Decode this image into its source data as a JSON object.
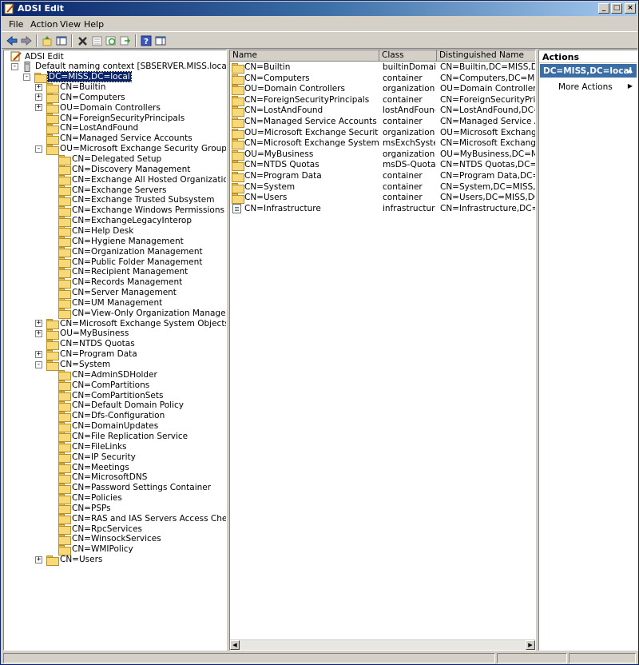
{
  "window": {
    "title": "ADSI Edit"
  },
  "menu": [
    "File",
    "Action",
    "View",
    "Help"
  ],
  "toolbar": [
    "back-icon",
    "forward-icon",
    "up-icon",
    "show-hide-tree-icon",
    "delete-icon",
    "properties-icon",
    "refresh-icon",
    "export-icon",
    "help-icon",
    "action-pane-icon"
  ],
  "tree": [
    {
      "label": "ADSI Edit",
      "level": 0,
      "expander": "",
      "icon": "adsi-icon"
    },
    {
      "label": "Default naming context [SBSERVER.MISS.local]",
      "level": 1,
      "expander": "-",
      "icon": "server-icon"
    },
    {
      "label": "DC=MISS,DC=local",
      "level": 2,
      "expander": "-",
      "icon": "folder",
      "selected": true
    },
    {
      "label": "CN=Builtin",
      "level": 3,
      "expander": "+",
      "icon": "folder"
    },
    {
      "label": "CN=Computers",
      "level": 3,
      "expander": "+",
      "icon": "folder"
    },
    {
      "label": "OU=Domain Controllers",
      "level": 3,
      "expander": "+",
      "icon": "folder"
    },
    {
      "label": "CN=ForeignSecurityPrincipals",
      "level": 3,
      "expander": "",
      "icon": "folder"
    },
    {
      "label": "CN=LostAndFound",
      "level": 3,
      "expander": "",
      "icon": "folder"
    },
    {
      "label": "CN=Managed Service Accounts",
      "level": 3,
      "expander": "",
      "icon": "folder"
    },
    {
      "label": "OU=Microsoft Exchange Security Groups",
      "level": 3,
      "expander": "-",
      "icon": "folder"
    },
    {
      "label": "CN=Delegated Setup",
      "level": 4,
      "expander": "",
      "icon": "folder"
    },
    {
      "label": "CN=Discovery Management",
      "level": 4,
      "expander": "",
      "icon": "folder"
    },
    {
      "label": "CN=Exchange All Hosted Organizations",
      "level": 4,
      "expander": "",
      "icon": "folder"
    },
    {
      "label": "CN=Exchange Servers",
      "level": 4,
      "expander": "",
      "icon": "folder"
    },
    {
      "label": "CN=Exchange Trusted Subsystem",
      "level": 4,
      "expander": "",
      "icon": "folder"
    },
    {
      "label": "CN=Exchange Windows Permissions",
      "level": 4,
      "expander": "",
      "icon": "folder"
    },
    {
      "label": "CN=ExchangeLegacyInterop",
      "level": 4,
      "expander": "",
      "icon": "folder"
    },
    {
      "label": "CN=Help Desk",
      "level": 4,
      "expander": "",
      "icon": "folder"
    },
    {
      "label": "CN=Hygiene Management",
      "level": 4,
      "expander": "",
      "icon": "folder"
    },
    {
      "label": "CN=Organization Management",
      "level": 4,
      "expander": "",
      "icon": "folder"
    },
    {
      "label": "CN=Public Folder Management",
      "level": 4,
      "expander": "",
      "icon": "folder"
    },
    {
      "label": "CN=Recipient Management",
      "level": 4,
      "expander": "",
      "icon": "folder"
    },
    {
      "label": "CN=Records Management",
      "level": 4,
      "expander": "",
      "icon": "folder"
    },
    {
      "label": "CN=Server Management",
      "level": 4,
      "expander": "",
      "icon": "folder"
    },
    {
      "label": "CN=UM Management",
      "level": 4,
      "expander": "",
      "icon": "folder"
    },
    {
      "label": "CN=View-Only Organization Management",
      "level": 4,
      "expander": "",
      "icon": "folder"
    },
    {
      "label": "CN=Microsoft Exchange System Objects",
      "level": 3,
      "expander": "+",
      "icon": "folder"
    },
    {
      "label": "OU=MyBusiness",
      "level": 3,
      "expander": "+",
      "icon": "folder"
    },
    {
      "label": "CN=NTDS Quotas",
      "level": 3,
      "expander": "",
      "icon": "folder"
    },
    {
      "label": "CN=Program Data",
      "level": 3,
      "expander": "+",
      "icon": "folder"
    },
    {
      "label": "CN=System",
      "level": 3,
      "expander": "-",
      "icon": "folder"
    },
    {
      "label": "CN=AdminSDHolder",
      "level": 4,
      "expander": "",
      "icon": "folder"
    },
    {
      "label": "CN=ComPartitions",
      "level": 4,
      "expander": "",
      "icon": "folder"
    },
    {
      "label": "CN=ComPartitionSets",
      "level": 4,
      "expander": "",
      "icon": "folder"
    },
    {
      "label": "CN=Default Domain Policy",
      "level": 4,
      "expander": "",
      "icon": "folder"
    },
    {
      "label": "CN=Dfs-Configuration",
      "level": 4,
      "expander": "",
      "icon": "folder"
    },
    {
      "label": "CN=DomainUpdates",
      "level": 4,
      "expander": "",
      "icon": "folder"
    },
    {
      "label": "CN=File Replication Service",
      "level": 4,
      "expander": "",
      "icon": "folder"
    },
    {
      "label": "CN=FileLinks",
      "level": 4,
      "expander": "",
      "icon": "folder"
    },
    {
      "label": "CN=IP Security",
      "level": 4,
      "expander": "",
      "icon": "folder"
    },
    {
      "label": "CN=Meetings",
      "level": 4,
      "expander": "",
      "icon": "folder"
    },
    {
      "label": "CN=MicrosoftDNS",
      "level": 4,
      "expander": "",
      "icon": "folder"
    },
    {
      "label": "CN=Password Settings Container",
      "level": 4,
      "expander": "",
      "icon": "folder"
    },
    {
      "label": "CN=Policies",
      "level": 4,
      "expander": "",
      "icon": "folder"
    },
    {
      "label": "CN=PSPs",
      "level": 4,
      "expander": "",
      "icon": "folder"
    },
    {
      "label": "CN=RAS and IAS Servers Access Check",
      "level": 4,
      "expander": "",
      "icon": "folder"
    },
    {
      "label": "CN=RpcServices",
      "level": 4,
      "expander": "",
      "icon": "folder"
    },
    {
      "label": "CN=WinsockServices",
      "level": 4,
      "expander": "",
      "icon": "folder"
    },
    {
      "label": "CN=WMIPolicy",
      "level": 4,
      "expander": "",
      "icon": "folder"
    },
    {
      "label": "CN=Users",
      "level": 3,
      "expander": "+",
      "icon": "folder"
    }
  ],
  "list": {
    "columns": [
      "Name",
      "Class",
      "Distinguished Name"
    ],
    "rows": [
      {
        "icon": "folder",
        "name": "CN=Builtin",
        "class": "builtinDomain",
        "dn": "CN=Builtin,DC=MISS,DC=local"
      },
      {
        "icon": "folder",
        "name": "CN=Computers",
        "class": "container",
        "dn": "CN=Computers,DC=MISS,DC=l"
      },
      {
        "icon": "folder",
        "name": "OU=Domain Controllers",
        "class": "organizationa...",
        "dn": "OU=Domain Controllers,DC=MISS"
      },
      {
        "icon": "folder",
        "name": "CN=ForeignSecurityPrincipals",
        "class": "container",
        "dn": "CN=ForeignSecurityPrincipals,D"
      },
      {
        "icon": "folder",
        "name": "CN=LostAndFound",
        "class": "lostAndFound",
        "dn": "CN=LostAndFound,DC=MISS,DC"
      },
      {
        "icon": "folder",
        "name": "CN=Managed Service Accounts",
        "class": "container",
        "dn": "CN=Managed Service Accounts"
      },
      {
        "icon": "folder",
        "name": "OU=Microsoft Exchange Security Groups",
        "class": "organizationa...",
        "dn": "OU=Microsoft Exchange Secur"
      },
      {
        "icon": "folder",
        "name": "CN=Microsoft Exchange System Objects",
        "class": "msExchSyste...",
        "dn": "CN=Microsoft Exchange Syste"
      },
      {
        "icon": "folder",
        "name": "OU=MyBusiness",
        "class": "organizationa...",
        "dn": "OU=MyBusiness,DC=MISS,DC"
      },
      {
        "icon": "folder",
        "name": "CN=NTDS Quotas",
        "class": "msDS-Quota...",
        "dn": "CN=NTDS Quotas,DC=MISS,DC"
      },
      {
        "icon": "folder",
        "name": "CN=Program Data",
        "class": "container",
        "dn": "CN=Program Data,DC=MISS,D"
      },
      {
        "icon": "folder",
        "name": "CN=System",
        "class": "container",
        "dn": "CN=System,DC=MISS,DC=loc"
      },
      {
        "icon": "folder",
        "name": "CN=Users",
        "class": "container",
        "dn": "CN=Users,DC=MISS,DC=local"
      },
      {
        "icon": "file",
        "name": "CN=Infrastructure",
        "class": "infrastructure...",
        "dn": "CN=Infrastructure,DC=MISS,D"
      }
    ]
  },
  "actions": {
    "title": "Actions",
    "header": "DC=MISS,DC=local",
    "items": [
      "More Actions"
    ]
  }
}
